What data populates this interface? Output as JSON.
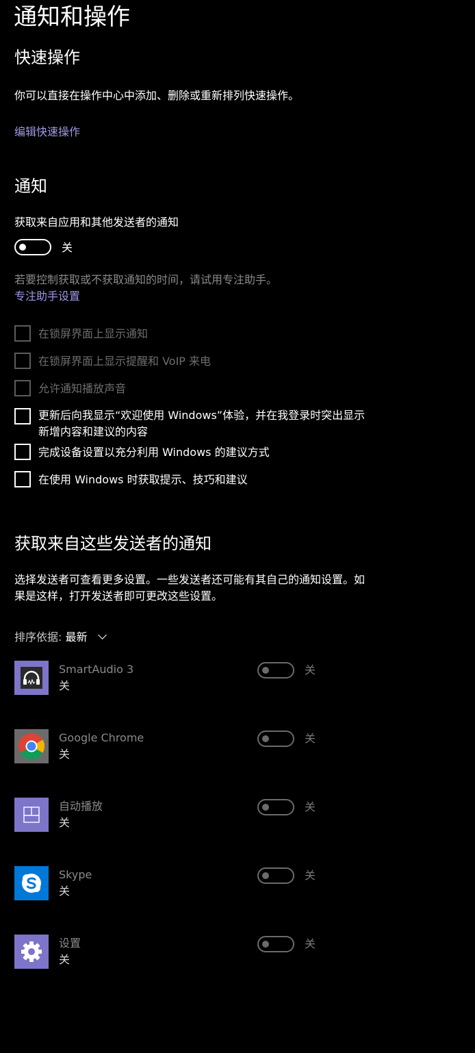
{
  "page": {
    "title": "通知和操作"
  },
  "quick_actions": {
    "heading": "快速操作",
    "description": "你可以直接在操作中心中添加、删除或重新排列快速操作。",
    "edit_link": "编辑快速操作"
  },
  "notifications": {
    "heading": "通知",
    "get_notifications_label": "获取来自应用和其他发送者的通知",
    "toggle_state": "关",
    "focus_hint": "若要控制获取或不获取通知的时间，请试用专注助手。",
    "focus_link": "专注助手设置",
    "checkboxes": [
      {
        "line1": "在锁屏界面上显示通知",
        "line2": "",
        "enabled": false,
        "checked": false
      },
      {
        "line1": "在锁屏界面上显示提醒和 VoIP 来电",
        "line2": "",
        "enabled": false,
        "checked": false
      },
      {
        "line1": "允许通知播放声音",
        "line2": "",
        "enabled": false,
        "checked": false
      },
      {
        "line1": "更新后向我显示“欢迎使用 Windows”体验，并在我登录时突出显示",
        "line2": "新增内容和建议的内容",
        "enabled": true,
        "checked": false
      },
      {
        "line1": "完成设备设置以充分利用 Windows 的建议方式",
        "line2": "",
        "enabled": true,
        "checked": false
      },
      {
        "line1": "在使用 Windows 时获取提示、技巧和建议",
        "line2": "",
        "enabled": true,
        "checked": false
      }
    ]
  },
  "senders": {
    "heading": "获取来自这些发送者的通知",
    "description_line1": "选择发送者可查看更多设置。一些发送者还可能有其自己的通知设置。如",
    "description_line2": "果是这样，打开发送者即可更改这些设置。",
    "sort_label": "排序依据:",
    "sort_value": "最新",
    "apps": [
      {
        "name": "SmartAudio 3",
        "state": "关",
        "toggle_label": "关",
        "icon": "headphones-icon",
        "tile_color": "#7d75c9"
      },
      {
        "name": "Google Chrome",
        "state": "关",
        "toggle_label": "关",
        "icon": "chrome-icon",
        "tile_color": "#6b6b6b"
      },
      {
        "name": "自动播放",
        "state": "关",
        "toggle_label": "关",
        "icon": "autoplay-icon",
        "tile_color": "#7d75c9"
      },
      {
        "name": "Skype",
        "state": "关",
        "toggle_label": "关",
        "icon": "skype-icon",
        "tile_color": "#0078d7"
      },
      {
        "name": "设置",
        "state": "关",
        "toggle_label": "关",
        "icon": "gear-icon",
        "tile_color": "#7d75c9"
      }
    ]
  },
  "colors": {
    "background": "#000000",
    "link": "#9f98e6",
    "text": "#ffffff",
    "disabled": "#6e6e6e"
  }
}
